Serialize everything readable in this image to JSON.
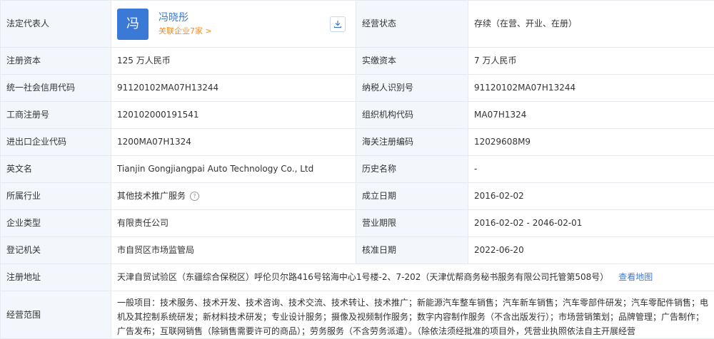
{
  "rows": {
    "legal_rep": {
      "label": "法定代表人",
      "avatar_char": "冯",
      "name": "冯晓彤",
      "related": "关联企业7家 >",
      "status_label": "经营状态",
      "status_value": "存续（在营、开业、在册）"
    },
    "capital": {
      "label": "注册资本",
      "value": "125 万人民币",
      "label2": "实缴资本",
      "value2": "7 万人民币"
    },
    "credit": {
      "label": "统一社会信用代码",
      "value": "91120102MA07H13244",
      "label2": "纳税人识别号",
      "value2": "91120102MA07H13244"
    },
    "reg_no": {
      "label": "工商注册号",
      "value": "120102000191541",
      "label2": "组织机构代码",
      "value2": "MA07H1324"
    },
    "import_export": {
      "label": "进出口企业代码",
      "value": "1200MA07H1324",
      "label2": "海关注册编码",
      "value2": "12029608M9"
    },
    "english": {
      "label": "英文名",
      "value": "Tianjin Gongjiangpai Auto Technology Co., Ltd",
      "label2": "历史名称",
      "value2": "-"
    },
    "industry": {
      "label": "所属行业",
      "value": "其他技术推广服务",
      "label2": "成立日期",
      "value2": "2016-02-02"
    },
    "company_type": {
      "label": "企业类型",
      "value": "有限责任公司",
      "label2": "营业期限",
      "value2": "2016-02-02 - 2046-02-01"
    },
    "authority": {
      "label": "登记机关",
      "value": "市自贸区市场监管局",
      "label2": "核准日期",
      "value2": "2022-06-20"
    },
    "address": {
      "label": "注册地址",
      "value": "天津自贸试验区（东疆综合保税区）呼伦贝尔路416号铭海中心1号楼-2、7-202（天津优帮商务秘书服务有限公司托管第508号）",
      "map_link": "查看地图"
    },
    "scope": {
      "label": "经营范围",
      "value": "一般项目：技术服务、技术开发、技术咨询、技术交流、技术转让、技术推广；新能源汽车整车销售；汽车新车销售；汽车零部件研发；汽车零配件销售；电机及其控制系统研发；新材料技术研发；专业设计服务；摄像及视频制作服务；数字内容制作服务（不含出版发行）；市场营销策划；品牌管理；广告制作；广告发布；互联网销售（除销售需要许可的商品）；劳务服务（不含劳务派遣）。（除依法须经批准的项目外，凭营业执照依法自主开展经营"
    }
  },
  "colors": {
    "label_bg": "#f3f6fb",
    "border": "#e6e9ef",
    "link": "#3b79d6",
    "orange": "#ff8a1a"
  }
}
